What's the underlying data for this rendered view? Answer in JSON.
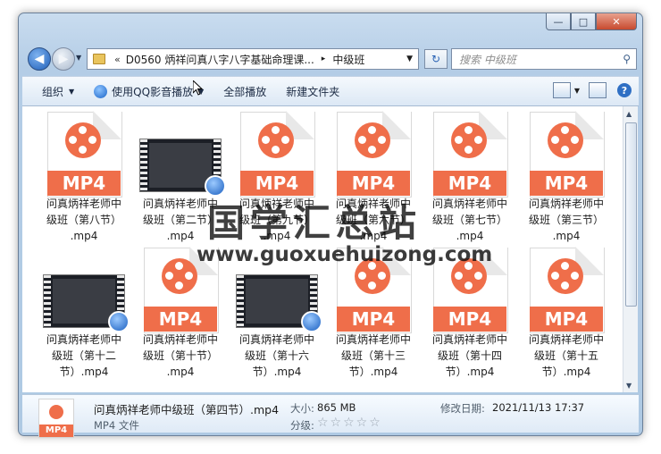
{
  "window": {
    "caption_buttons": {
      "minimize": "—",
      "maximize": "□",
      "close": "✕"
    }
  },
  "nav": {
    "address_prefix": "«",
    "address_folder": "D0560 炳祥问真八字八字基础命理课...",
    "address_sep": "▸",
    "address_current": "中级班",
    "search_placeholder": "搜索 中级班"
  },
  "toolbar": {
    "organize": "组织",
    "play_with_qq": "使用QQ影音播放",
    "play_all": "全部播放",
    "new_folder": "新建文件夹"
  },
  "files": [
    {
      "name_lines": [
        "问真炳祥老师中",
        "级班（第八节）",
        ".mp4"
      ],
      "kind": "mp4-icon"
    },
    {
      "name_lines": [
        "问真炳祥老师中",
        "级班（第二节）",
        ".mp4"
      ],
      "kind": "video-thumb"
    },
    {
      "name_lines": [
        "问真炳祥老师中",
        "级班（第九节）",
        ".mp4"
      ],
      "kind": "mp4-icon"
    },
    {
      "name_lines": [
        "问真炳祥老师中",
        "级班（第六节）",
        ".mp4"
      ],
      "kind": "mp4-icon"
    },
    {
      "name_lines": [
        "问真炳祥老师中",
        "级班（第七节）",
        ".mp4"
      ],
      "kind": "mp4-icon"
    },
    {
      "name_lines": [
        "问真炳祥老师中",
        "级班（第三节）",
        ".mp4"
      ],
      "kind": "mp4-icon"
    },
    {
      "name_lines": [
        "问真炳祥老师中",
        "级班（第十二",
        "节）.mp4"
      ],
      "kind": "video-thumb"
    },
    {
      "name_lines": [
        "问真炳祥老师中",
        "级班（第十节）",
        ".mp4"
      ],
      "kind": "mp4-icon"
    },
    {
      "name_lines": [
        "问真炳祥老师中",
        "级班（第十六",
        "节）.mp4"
      ],
      "kind": "video-thumb"
    },
    {
      "name_lines": [
        "问真炳祥老师中",
        "级班（第十三",
        "节）.mp4"
      ],
      "kind": "mp4-icon"
    },
    {
      "name_lines": [
        "问真炳祥老师中",
        "级班（第十四",
        "节）.mp4"
      ],
      "kind": "mp4-icon"
    },
    {
      "name_lines": [
        "问真炳祥老师中",
        "级班（第十五",
        "节）.mp4"
      ],
      "kind": "mp4-icon"
    }
  ],
  "mp4_label": "MP4",
  "details": {
    "name": "问真炳祥老师中级班（第四节）.mp4",
    "type": "MP4 文件",
    "size_label": "大小:",
    "size": "865 MB",
    "rating_label": "分级:",
    "stars": "☆☆☆☆☆",
    "modified_label": "修改日期:",
    "modified": "2021/11/13 17:37"
  },
  "watermark": {
    "cn": "国学汇总站",
    "url": "www.guoxuehuizong.com"
  },
  "colors": {
    "mp4_orange": "#ef6e4a",
    "window_frame": "#b4cde6"
  }
}
